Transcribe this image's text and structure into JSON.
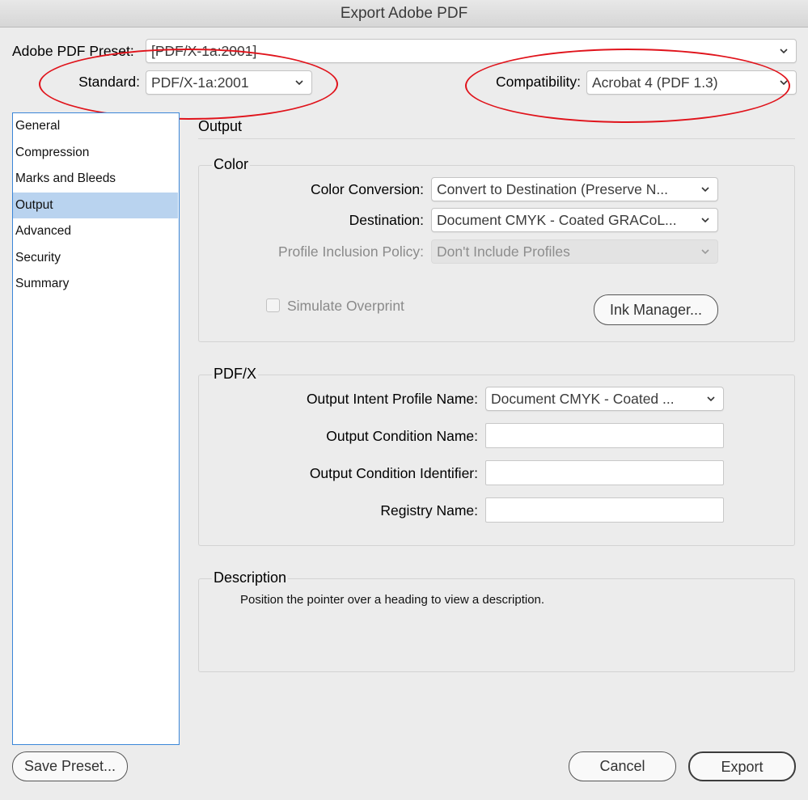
{
  "window": {
    "title": "Export Adobe PDF"
  },
  "preset": {
    "label": "Adobe PDF Preset:",
    "value": "[PDF/X-1a:2001]"
  },
  "standard": {
    "label": "Standard:",
    "value": "PDF/X-1a:2001"
  },
  "compatibility": {
    "label": "Compatibility:",
    "value": "Acrobat 4 (PDF 1.3)"
  },
  "sidebar": {
    "items": [
      {
        "label": "General"
      },
      {
        "label": "Compression"
      },
      {
        "label": "Marks and Bleeds"
      },
      {
        "label": "Output",
        "selected": true
      },
      {
        "label": "Advanced"
      },
      {
        "label": "Security"
      },
      {
        "label": "Summary"
      }
    ]
  },
  "panel": {
    "title": "Output"
  },
  "color": {
    "title": "Color",
    "conversion": {
      "label": "Color Conversion:",
      "value": "Convert to Destination (Preserve N..."
    },
    "destination": {
      "label": "Destination:",
      "value": "Document CMYK - Coated GRACoL..."
    },
    "profile_policy": {
      "label": "Profile Inclusion Policy:",
      "value": "Don't Include Profiles"
    },
    "simulate_overprint": {
      "label": "Simulate Overprint",
      "checked": false
    },
    "ink_manager": "Ink Manager..."
  },
  "pdfx": {
    "title": "PDF/X",
    "intent_profile": {
      "label": "Output Intent Profile Name:",
      "value": "Document CMYK - Coated ..."
    },
    "condition_name": {
      "label": "Output Condition Name:",
      "value": ""
    },
    "condition_identifier": {
      "label": "Output Condition Identifier:",
      "value": ""
    },
    "registry_name": {
      "label": "Registry Name:",
      "value": ""
    }
  },
  "description": {
    "title": "Description",
    "text": "Position the pointer over a heading to view a description."
  },
  "buttons": {
    "save_preset": "Save Preset...",
    "cancel": "Cancel",
    "export": "Export"
  },
  "annotation_color": "#e0131b",
  "selection_color": "#b9d3ef"
}
